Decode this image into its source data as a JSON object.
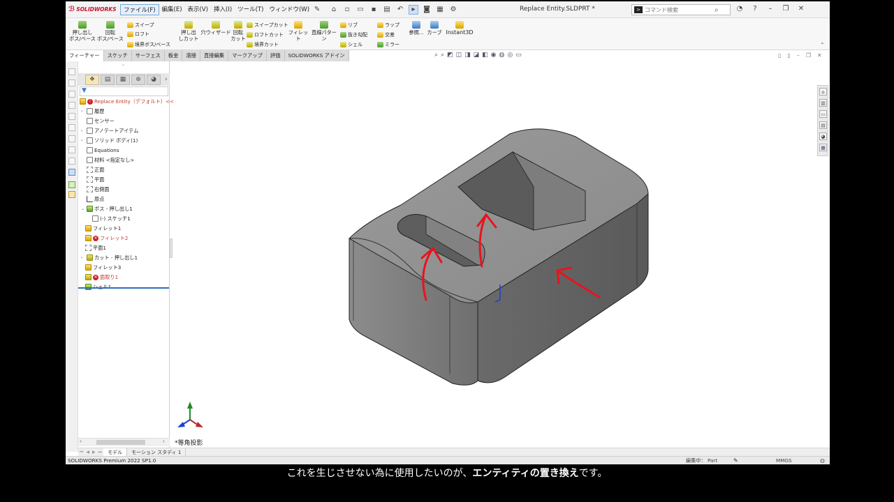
{
  "app": {
    "logo_text": "SOLIDWORKS",
    "document_title": "Replace Entity.SLDPRT *",
    "menu": [
      "ファイル(F)",
      "編集(E)",
      "表示(V)",
      "挿入(I)",
      "ツール(T)",
      "ウィンドウ(W)"
    ],
    "search_placeholder": "コマンド検索"
  },
  "ribbon": {
    "extrude_boss": "押し出し\nボス/ベース",
    "revolve_boss": "回転\nボス/ベース",
    "sweep": "スイープ",
    "loft": "ロフト",
    "boundary_boss": "境界ボス/ベース",
    "extrude_cut": "押し出\nしカット",
    "hole_wizard": "穴ウィザード",
    "revolve_cut": "回転\nカット",
    "swept_cut": "スイープカット",
    "lofted_cut": "ロフトカット",
    "boundary_cut": "境界カット",
    "fillet": "フィレット",
    "linear_pattern": "直線パターン",
    "rib": "リブ",
    "draft": "抜き勾配",
    "shell": "シェル",
    "wrap": "ラップ",
    "intersect": "交差",
    "mirror": "ミラー",
    "reference": "参照...",
    "curves": "カーブ",
    "instant3d": "Instant3D"
  },
  "command_tabs": [
    "フィーチャー",
    "スケッチ",
    "サーフェス",
    "板金",
    "溶接",
    "直接編集",
    "マークアップ",
    "評価",
    "SOLIDWORKS アドイン"
  ],
  "tree": {
    "root": "Replace Entity（デフォルト）<<",
    "items": [
      {
        "label": "履歴",
        "icon": "history-icon"
      },
      {
        "label": "センサー",
        "icon": "sensor-icon"
      },
      {
        "label": "アノテートアイテム",
        "icon": "annotation-icon"
      },
      {
        "label": "ソリッド ボディ(1)",
        "icon": "solid-body-icon"
      },
      {
        "label": "Equations",
        "icon": "equations-icon"
      },
      {
        "label": "材料 <指定なし>",
        "icon": "material-icon"
      },
      {
        "label": "正面",
        "icon": "plane-icon"
      },
      {
        "label": "平面",
        "icon": "plane-icon"
      },
      {
        "label": "右側面",
        "icon": "plane-icon"
      },
      {
        "label": "原点",
        "icon": "origin-icon"
      },
      {
        "label": "ボス - 押し出し1",
        "icon": "boss-extrude-icon"
      },
      {
        "label": "(-) スケッチ1",
        "icon": "sketch-icon"
      },
      {
        "label": "フィレット1",
        "icon": "fillet-icon"
      },
      {
        "label": "フィレット2",
        "icon": "fillet-icon",
        "error": true
      },
      {
        "label": "平面1",
        "icon": "plane-icon"
      },
      {
        "label": "カット - 押し出し1",
        "icon": "cut-extrude-icon"
      },
      {
        "label": "フィレット3",
        "icon": "fillet-icon"
      },
      {
        "label": "面取り1",
        "icon": "chamfer-icon",
        "error": true
      },
      {
        "label": "シェル1",
        "icon": "shell-icon"
      }
    ]
  },
  "viewport": {
    "view_label": "*等角投影"
  },
  "bottom_tabs": [
    "モデル",
    "モーション スタディ 1"
  ],
  "status": {
    "product": "SOLIDWORKS Premium 2022 SP1.0",
    "mode": "編集中： Part",
    "units": "MMGS"
  },
  "caption": {
    "text_before": "これを生じさせない為に使用したいのが、",
    "emphasis": "エンティティの置き換え",
    "text_after": "です。"
  },
  "colors": {
    "error_red": "#d21f1f",
    "annotation_red": "#e8141c",
    "selection_blue": "#2c6fb8"
  }
}
